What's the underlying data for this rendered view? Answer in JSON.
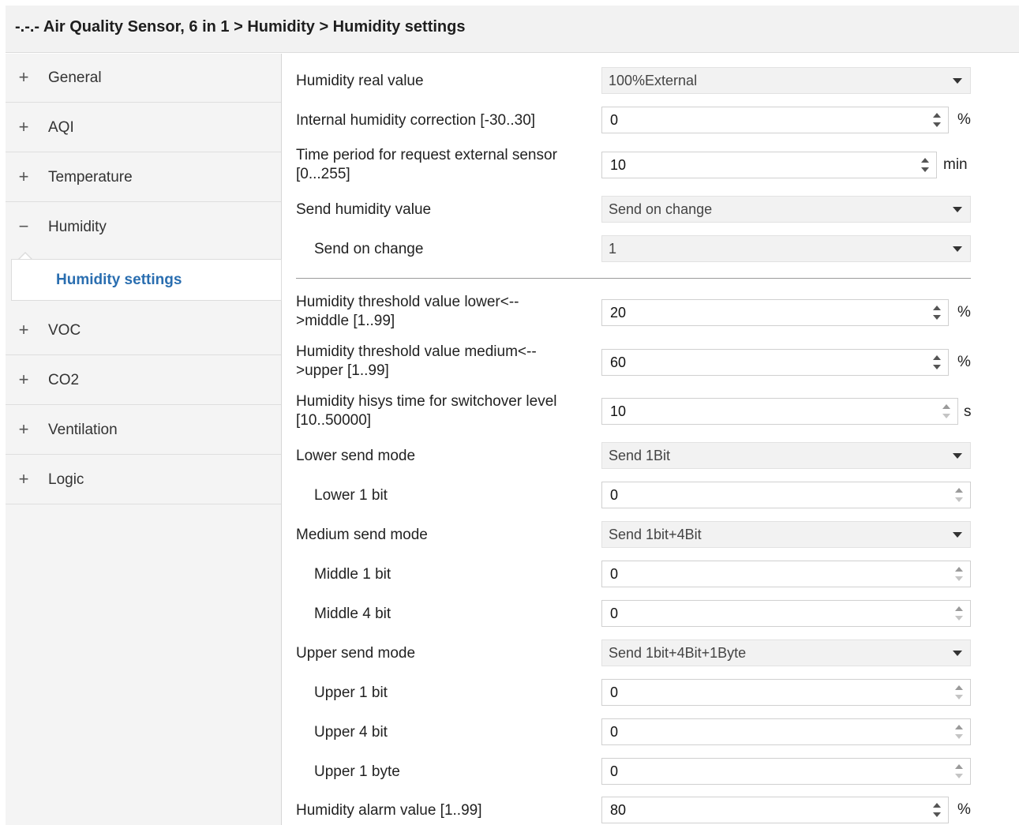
{
  "window": {
    "breadcrumb": "-.-.- Air Quality Sensor, 6 in 1 > Humidity > Humidity settings"
  },
  "colors": {
    "accent": "#2a6eb0",
    "sidebar_bg": "#f4f4f4",
    "select_bg": "#f2f2f2"
  },
  "sidebar": {
    "items": [
      {
        "label": "General",
        "toggle": "+"
      },
      {
        "label": "AQI",
        "toggle": "+"
      },
      {
        "label": "Temperature",
        "toggle": "+"
      },
      {
        "label": "Humidity",
        "toggle": "−"
      },
      {
        "label": "VOC",
        "toggle": "+"
      },
      {
        "label": "CO2",
        "toggle": "+"
      },
      {
        "label": "Ventilation",
        "toggle": "+"
      },
      {
        "label": "Logic",
        "toggle": "+"
      }
    ],
    "active_sub": "Humidity settings"
  },
  "form": {
    "humidity_real_value": {
      "label": "Humidity real value",
      "value": "100%External"
    },
    "internal_correction": {
      "label": "Internal humidity correction [-30..30]",
      "value": "0",
      "unit": "%"
    },
    "time_period_line1": "Time period for request external sensor",
    "time_period_line2": "[0...255]",
    "time_period": {
      "value": "10",
      "unit": "min"
    },
    "send_humidity_value": {
      "label": "Send humidity value",
      "value": "Send on change"
    },
    "send_on_change": {
      "label": "Send on change",
      "value": "1"
    },
    "threshold_lower_line1": "Humidity threshold value lower<--",
    "threshold_lower_line2": ">middle [1..99]",
    "threshold_lower": {
      "value": "20",
      "unit": "%"
    },
    "threshold_medium_line1": "Humidity threshold value medium<--",
    "threshold_medium_line2": ">upper [1..99]",
    "threshold_medium": {
      "value": "60",
      "unit": "%"
    },
    "hisys_line1": "Humidity hisys time for switchover level",
    "hisys_line2": "[10..50000]",
    "hisys": {
      "value": "10",
      "unit": "s"
    },
    "lower_send_mode": {
      "label": "Lower send mode",
      "value": "Send 1Bit"
    },
    "lower_1bit": {
      "label": "Lower 1 bit",
      "value": "0"
    },
    "medium_send_mode": {
      "label": "Medium send mode",
      "value": "Send 1bit+4Bit"
    },
    "middle_1bit": {
      "label": "Middle 1 bit",
      "value": "0"
    },
    "middle_4bit": {
      "label": "Middle 4 bit",
      "value": "0"
    },
    "upper_send_mode": {
      "label": "Upper send mode",
      "value": "Send 1bit+4Bit+1Byte"
    },
    "upper_1bit": {
      "label": "Upper 1 bit",
      "value": "0"
    },
    "upper_4bit": {
      "label": "Upper 4 bit",
      "value": "0"
    },
    "upper_1byte": {
      "label": "Upper 1 byte",
      "value": "0"
    },
    "alarm_value": {
      "label": "Humidity alarm value [1..99]",
      "value": "80",
      "unit": "%"
    }
  }
}
